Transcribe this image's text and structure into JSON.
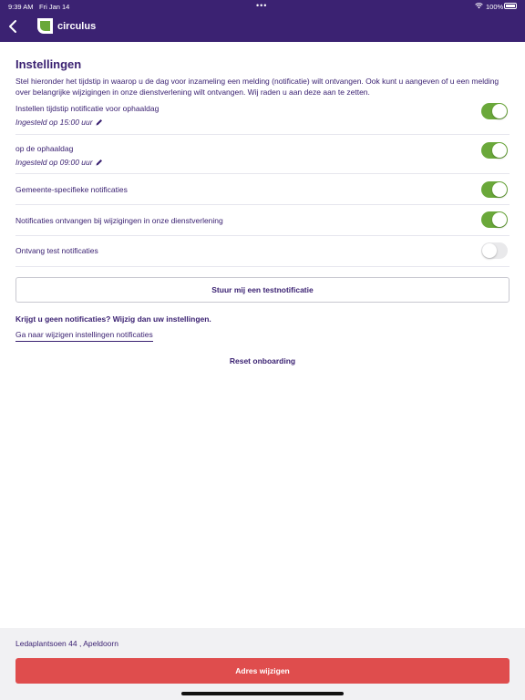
{
  "status_bar": {
    "time": "9:39 AM",
    "date": "Fri Jan 14",
    "multitask_dots": "•••",
    "battery": "100%",
    "icons": [
      "wifi-icon",
      "battery-icon"
    ]
  },
  "header": {
    "back_icon": "chevron-left-icon",
    "logo_icon": "leaf-logo-icon",
    "brand": "circulus"
  },
  "colors": {
    "header_bg": "#3b2272",
    "text": "#3b2272",
    "toggle_on": "#6aa83a",
    "toggle_off": "#e9e9eb",
    "primary_button": "#df4d4d",
    "bottom_panel": "#f1f1f3"
  },
  "settings": {
    "title": "Instellingen",
    "intro": "Stel hieronder het tijdstip in waarop u de dag voor inzameling een melding (notificatie) wilt ontvangen. Ook kunt u aangeven of u een melding over belangrijke wijzigingen in onze dienstverlening wilt ontvangen. Wij raden u aan deze aan te zetten.",
    "rows": [
      {
        "label": "Instellen tijdstip notificatie voor ophaaldag",
        "sub": "Ingesteld op 15:00 uur",
        "enabled": true,
        "edit_icon": "pencil-icon"
      },
      {
        "label": "op de ophaaldag",
        "sub": "Ingesteld op 09:00 uur",
        "enabled": true,
        "edit_icon": "pencil-icon"
      },
      {
        "label": "Gemeente-specifieke notificaties",
        "enabled": true
      },
      {
        "label": "Notificaties ontvangen bij wijzigingen in onze dienstverlening",
        "enabled": true
      },
      {
        "label": "Ontvang test notificaties",
        "enabled": false
      }
    ],
    "test_button": "Stuur mij een testnotificatie",
    "no_notifications": "Krijgt u geen notificaties? Wijzig dan uw instellingen.",
    "settings_link": "Ga naar wijzigen instellingen notificaties",
    "reset": "Reset onboarding"
  },
  "footer": {
    "address": "Ledaplantsoen 44  , Apeldoorn",
    "change_button": "Adres wijzigen"
  }
}
